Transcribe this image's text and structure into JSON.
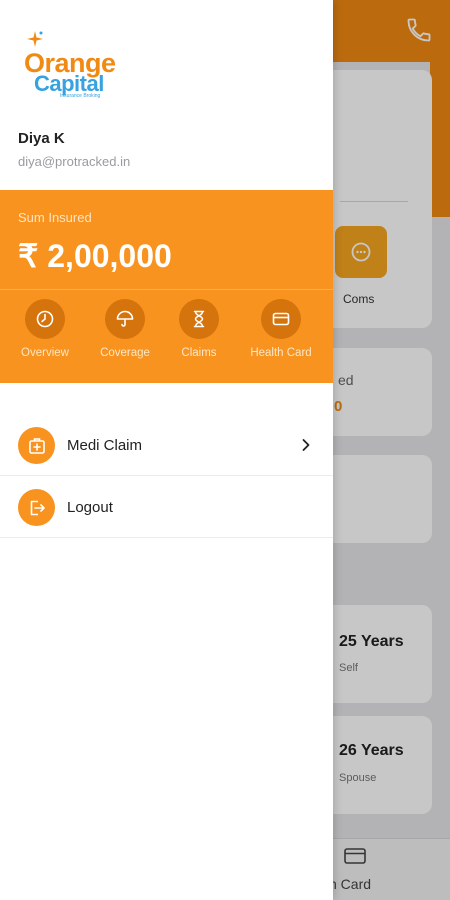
{
  "drawer": {
    "logo": {
      "line1": "Orange",
      "line2": "Capital",
      "tagline": "Insurance Broking"
    },
    "user": {
      "name": "Diya K",
      "email": "diya@protracked.in"
    },
    "sum_insured": {
      "label": "Sum Insured",
      "value": "₹ 2,00,000"
    },
    "quick_actions": [
      {
        "label": "Overview",
        "icon": "clock-icon"
      },
      {
        "label": "Coverage",
        "icon": "umbrella-icon"
      },
      {
        "label": "Claims",
        "icon": "hourglass-icon"
      },
      {
        "label": "Health Card",
        "icon": "card-icon"
      }
    ],
    "menu": [
      {
        "label": "Medi Claim",
        "icon": "medical-kit-icon",
        "has_chevron": true
      },
      {
        "label": "Logout",
        "icon": "logout-icon",
        "has_chevron": false
      }
    ]
  },
  "background": {
    "coms_label": "Coms",
    "partial_label": "ed",
    "partial_value": "0",
    "members": [
      {
        "age": "25 Years",
        "relation": "Self"
      },
      {
        "age": "26 Years",
        "relation": "Spouse"
      }
    ],
    "bottom_nav_label": "lth Card"
  },
  "colors": {
    "brand_orange": "#f7931e",
    "logo_blue": "#36a2e0",
    "icon_dark_orange": "#d5730d"
  }
}
